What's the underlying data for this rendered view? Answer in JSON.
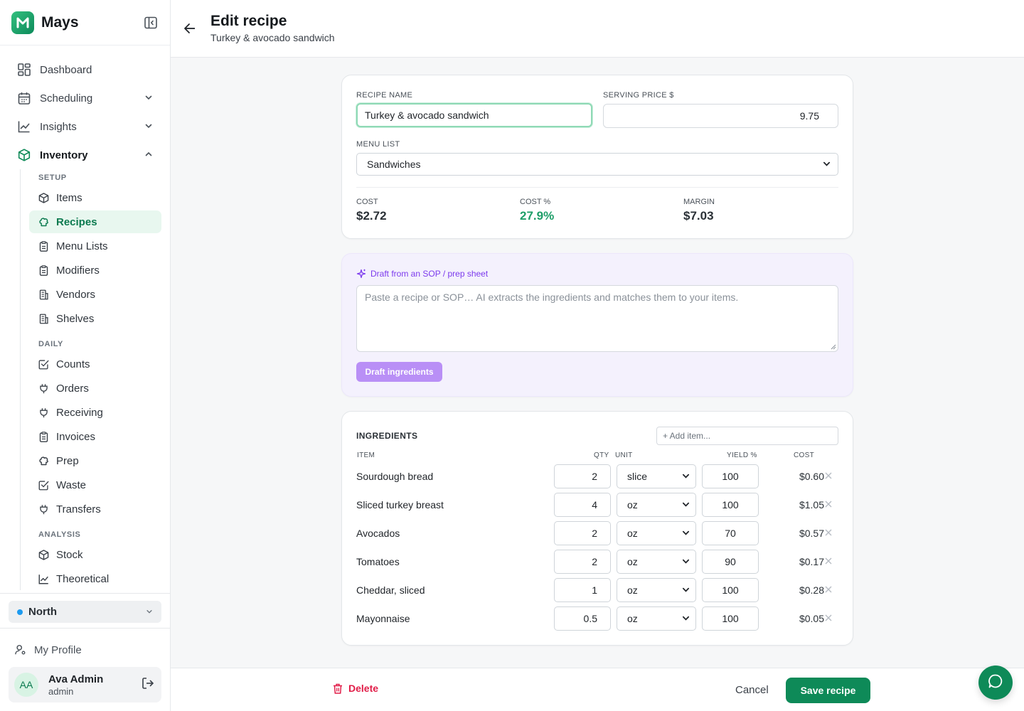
{
  "app": {
    "name": "Mays"
  },
  "sidebar": {
    "top_items": [
      {
        "label": "Dashboard",
        "icon": "dashboard-icon"
      },
      {
        "label": "Scheduling",
        "icon": "calendar-icon"
      },
      {
        "label": "Insights",
        "icon": "chart-line-icon"
      },
      {
        "label": "Inventory",
        "icon": "box-icon"
      }
    ],
    "sections": {
      "setup": "SETUP",
      "daily": "DAILY",
      "analysis": "ANALYSIS"
    },
    "setup_items": [
      "Items",
      "Recipes",
      "Menu Lists",
      "Modifiers",
      "Vendors",
      "Shelves"
    ],
    "daily_items": [
      "Counts",
      "Orders",
      "Receiving",
      "Invoices",
      "Prep",
      "Waste",
      "Transfers"
    ],
    "analysis_items": [
      "Stock",
      "Theoretical"
    ],
    "active_item": "Recipes",
    "location": "North",
    "profile_label": "My Profile",
    "user": {
      "initials": "AA",
      "name": "Ava Admin",
      "role": "admin"
    }
  },
  "header": {
    "title": "Edit recipe",
    "subtitle": "Turkey & avocado sandwich"
  },
  "form": {
    "recipe_name_label": "RECIPE NAME",
    "recipe_name_value": "Turkey & avocado sandwich",
    "serving_price_label": "SERVING PRICE $",
    "serving_price_value": "9.75",
    "menu_list_label": "MENU LIST",
    "menu_list_value": "Sandwiches",
    "metrics": {
      "cost_label": "COST",
      "cost_value": "$2.72",
      "cost_pct_label": "COST %",
      "cost_pct_value": "27.9%",
      "margin_label": "MARGIN",
      "margin_value": "$7.03"
    }
  },
  "draft": {
    "title": "Draft from an SOP / prep sheet",
    "placeholder": "Paste a recipe or SOP… AI extracts the ingredients and matches them to your items.",
    "button": "Draft ingredients"
  },
  "ingredients": {
    "title": "INGREDIENTS",
    "add_placeholder": "+ Add item...",
    "columns": {
      "item": "ITEM",
      "qty": "QTY",
      "unit": "UNIT",
      "yield": "YIELD %",
      "cost": "COST"
    },
    "rows": [
      {
        "name": "Sourdough bread",
        "qty": "2",
        "unit": "slice",
        "yield": "100",
        "cost": "$0.60"
      },
      {
        "name": "Sliced turkey breast",
        "qty": "4",
        "unit": "oz",
        "yield": "100",
        "cost": "$1.05"
      },
      {
        "name": "Avocados",
        "qty": "2",
        "unit": "oz",
        "yield": "70",
        "cost": "$0.57"
      },
      {
        "name": "Tomatoes",
        "qty": "2",
        "unit": "oz",
        "yield": "90",
        "cost": "$0.17"
      },
      {
        "name": "Cheddar, sliced",
        "qty": "1",
        "unit": "oz",
        "yield": "100",
        "cost": "$0.28"
      },
      {
        "name": "Mayonnaise",
        "qty": "0.5",
        "unit": "oz",
        "yield": "100",
        "cost": "$0.05"
      }
    ]
  },
  "actions": {
    "delete": "Delete",
    "cancel": "Cancel",
    "save": "Save recipe"
  },
  "colors": {
    "brand": "#0e8a58",
    "accent_purple": "#7c3aed",
    "danger": "#e11d48"
  }
}
